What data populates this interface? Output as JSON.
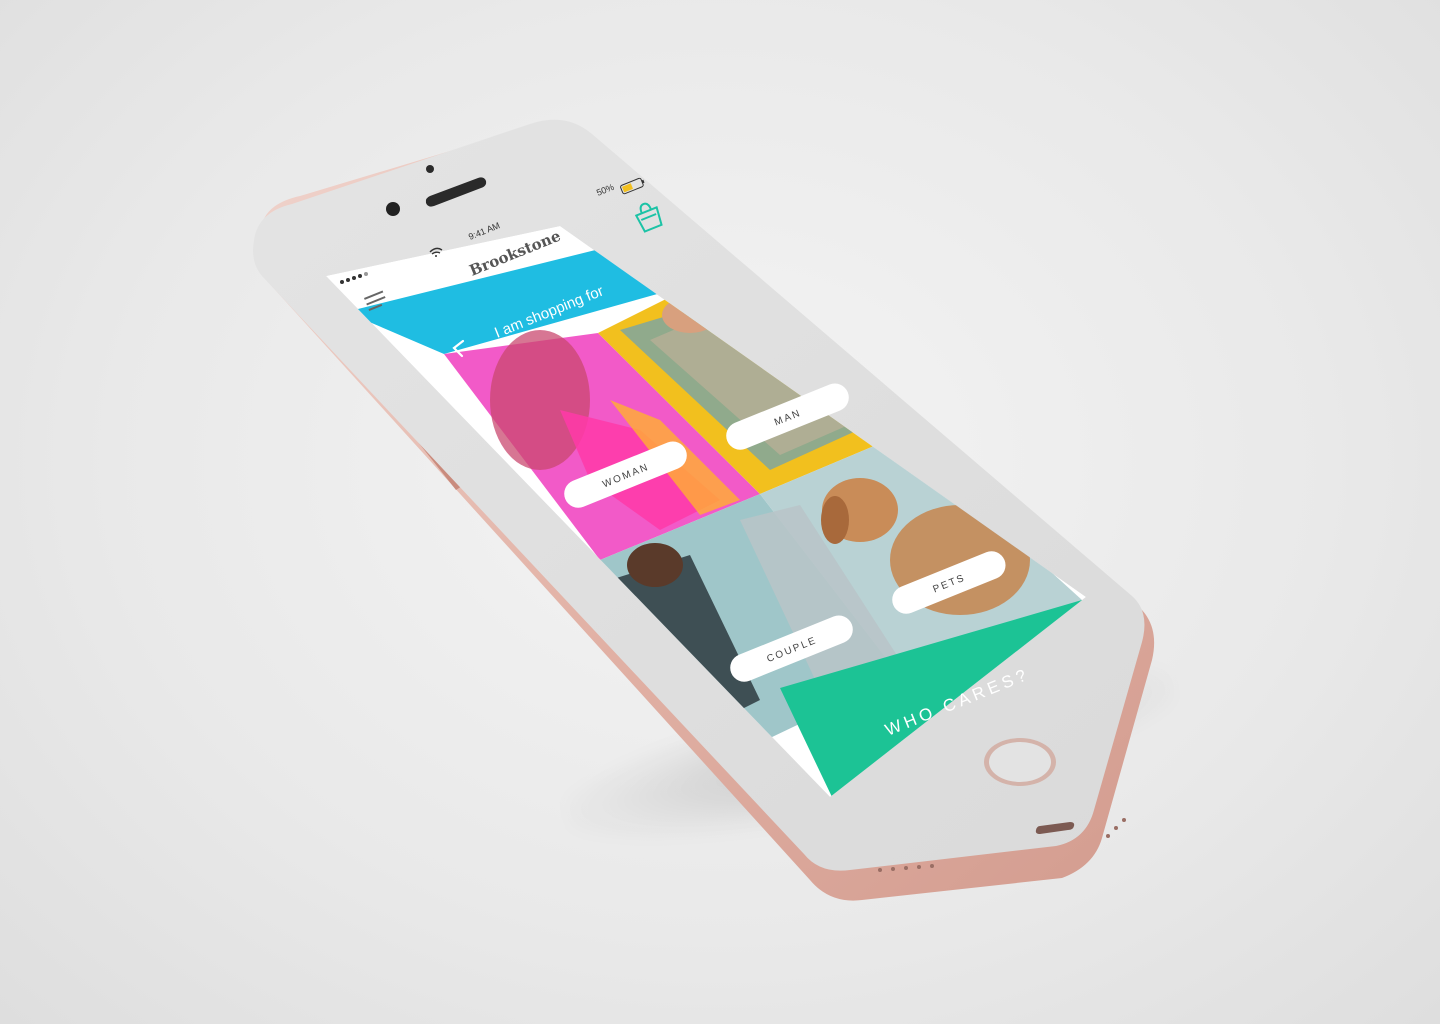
{
  "device": {
    "status_bar": {
      "time": "9:41 AM",
      "battery_percent": "50%",
      "battery_level": 0.5
    }
  },
  "app": {
    "brand": "Brookstone",
    "header": {
      "menu_icon": "hamburger-menu-icon",
      "cart_icon": "shopping-bag-icon"
    },
    "banner": {
      "title": "I am shopping for",
      "back_icon": "chevron-left-icon",
      "background": "#1fbde2"
    },
    "categories": [
      {
        "label": "WOMAN",
        "color": "#f25ac8"
      },
      {
        "label": "MAN",
        "color": "#f2c01e"
      },
      {
        "label": "COUPLE",
        "color": "#9fc6c9"
      },
      {
        "label": "PETS",
        "color": "#b9d2d4"
      }
    ],
    "cta": {
      "label": "WHO CARES?",
      "background": "#1cc395"
    }
  },
  "colors": {
    "phone_frame": "#e1e1e1",
    "phone_shell": "#e6b9ae",
    "cart_accent": "#1cc3a6"
  }
}
